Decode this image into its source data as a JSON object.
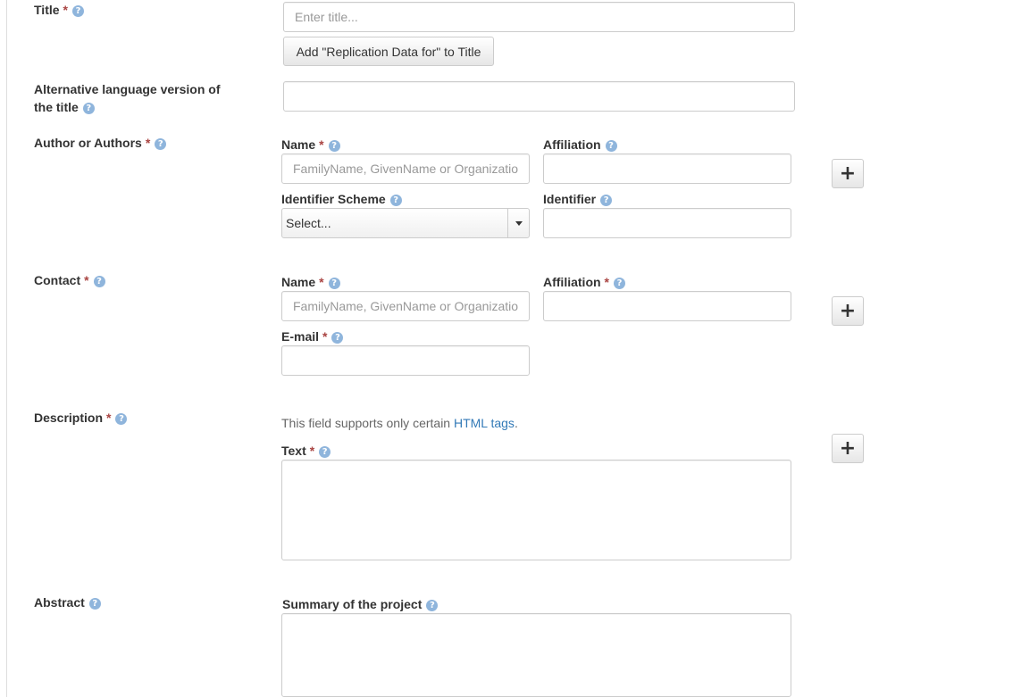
{
  "title_field": {
    "label": "Title",
    "required": "*",
    "input_placeholder": "Enter title...",
    "input_value": "",
    "add_button_label": "Add \"Replication Data for\" to Title"
  },
  "alt_title_field": {
    "label_line1": "Alternative language version of",
    "label_line2": "the title",
    "input_value": ""
  },
  "author_field": {
    "label": "Author or Authors",
    "required": "*",
    "name_label": "Name",
    "name_placeholder": "FamilyName, GivenName or Organization",
    "affiliation_label": "Affiliation",
    "identifier_scheme_label": "Identifier Scheme",
    "identifier_scheme_value": "Select...",
    "identifier_label": "Identifier",
    "add_button_label": "+"
  },
  "contact_field": {
    "label": "Contact",
    "required": "*",
    "name_label": "Name",
    "name_placeholder": "FamilyName, GivenName or Organization",
    "affiliation_label": "Affiliation",
    "email_label": "E-mail",
    "add_button_label": "+"
  },
  "description_field": {
    "label": "Description",
    "required": "*",
    "help_text_prefix": "This field supports only certain ",
    "help_text_link": "HTML tags",
    "help_text_suffix": ".",
    "text_label": "Text",
    "add_button_label": "+"
  },
  "abstract_field": {
    "label": "Abstract",
    "summary_label": "Summary of the project"
  },
  "help_icon_glyph": "?",
  "colors": {
    "required": "#a94442",
    "help_icon": "#8fb5dc",
    "link": "#337ab7",
    "border": "#cccccc"
  }
}
